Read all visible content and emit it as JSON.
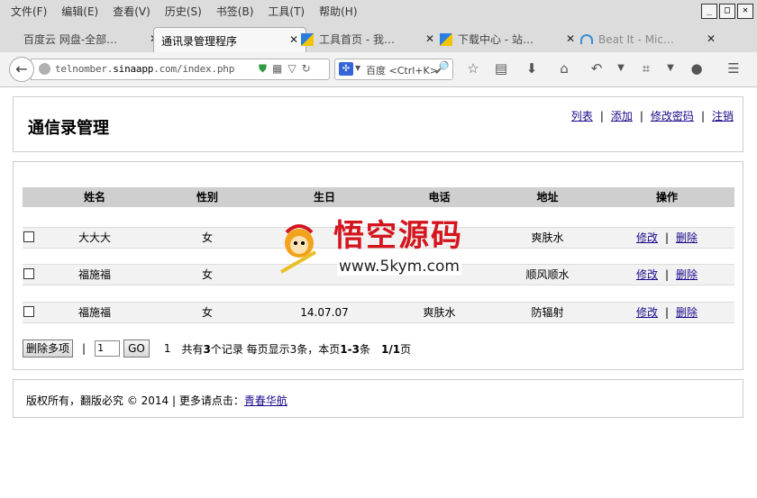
{
  "browser": {
    "menu": [
      "文件(F)",
      "编辑(E)",
      "查看(V)",
      "历史(S)",
      "书签(B)",
      "工具(T)",
      "帮助(H)"
    ],
    "tabs": [
      {
        "label": "百度云 网盘-全部…",
        "active": false
      },
      {
        "label": "通讯录管理程序",
        "active": true
      },
      {
        "label": "工具首页 - 我…",
        "active": false
      },
      {
        "label": "下载中心 - 站…",
        "active": false
      },
      {
        "label": "Beat It - Mic…",
        "active": false
      }
    ],
    "url_prefix": "telnomber.",
    "url_domain": "sinaapp",
    "url_suffix": ".com/index.php",
    "search_engine": "百度",
    "search_placeholder": "百度 <Ctrl+K>"
  },
  "page": {
    "title": "通信录管理",
    "nav": {
      "list": "列表",
      "add": "添加",
      "change_password": "修改密码",
      "logout": "注销"
    },
    "table": {
      "headers": [
        "姓名",
        "性别",
        "生日",
        "电话",
        "地址",
        "操作"
      ],
      "rows": [
        {
          "name": "大大大",
          "sex": "女",
          "birthday": "",
          "phone": "",
          "address": "爽肤水"
        },
        {
          "name": "福施福",
          "sex": "女",
          "birthday": "",
          "phone": "",
          "address": "顺风顺水"
        },
        {
          "name": "福施福",
          "sex": "女",
          "birthday": "14.07.07",
          "phone": "爽肤水",
          "address": "防辐射"
        }
      ],
      "edit_label": "修改",
      "delete_label": "删除"
    },
    "pager": {
      "delete_multi": "删除多项",
      "page_input": "1",
      "go_label": "GO",
      "current": "1",
      "summary_prefix": "共有",
      "total": "3",
      "summary_mid": "个记录  每页显示3条，本页",
      "range": "1-3",
      "unit": "条",
      "pages": "1/1",
      "page_unit": "页"
    },
    "footer": {
      "text": "版权所有，翻版必究 © 2014 | 更多请点击：",
      "link": "青春华航"
    },
    "watermark": {
      "title": "悟空源码",
      "url": "www.5kym.com"
    }
  },
  "colors": {
    "link": "#1a0a8b",
    "header_bg": "#cfcfcf",
    "row_bg": "#f2f2f2",
    "watermark_red": "#d4151d"
  }
}
